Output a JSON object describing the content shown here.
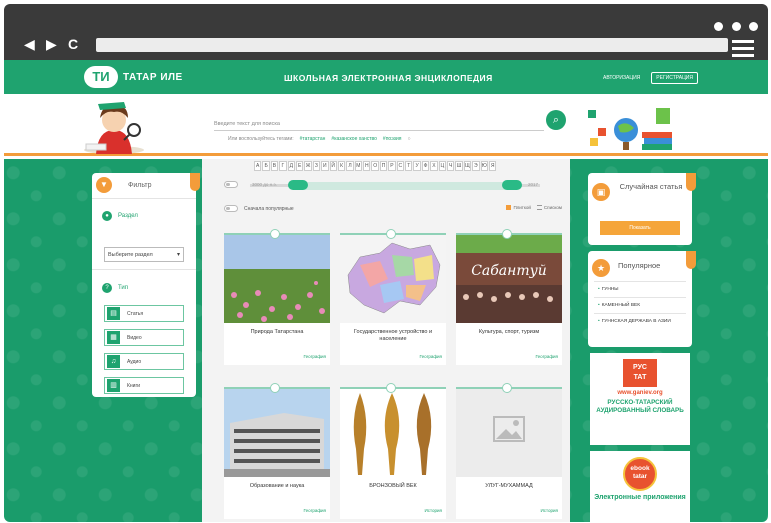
{
  "site": {
    "logo_mark": "ТИ",
    "logo_text": "ТАТАР ИЛЕ",
    "title": "ШКОЛЬНАЯ ЭЛЕКТРОННАЯ ЭНЦИКЛОПЕДИЯ",
    "login": "АВТОРИЗАЦИЯ",
    "register": "РЕГИСТРАЦИЯ"
  },
  "search": {
    "placeholder": "Введите текст для поиска",
    "hint_prefix": "Или воспользуйтесь тегами:",
    "tags": [
      "#татарстан",
      "#казанское ханство",
      "#поэзия"
    ]
  },
  "alphabet": [
    "А",
    "Б",
    "В",
    "Г",
    "Д",
    "Е",
    "Ж",
    "З",
    "И",
    "Й",
    "К",
    "Л",
    "М",
    "Н",
    "О",
    "П",
    "Р",
    "С",
    "Т",
    "У",
    "Ф",
    "Х",
    "Ц",
    "Ч",
    "Ш",
    "Щ",
    "Э",
    "Ю",
    "Я"
  ],
  "year_filter": {
    "from": "3000 до н.э.",
    "to": "2017",
    "range_fraction": [
      0.16,
      0.92
    ]
  },
  "list_options": {
    "popular_first": "Сначала популярные",
    "tile_view": "Плиткой",
    "list_view": "Списком"
  },
  "filter": {
    "title": "Фильтр",
    "section_label": "Раздел",
    "section_select": "Выберите раздел",
    "type_label": "Тип",
    "types": [
      "Статья",
      "Видео",
      "Аудио",
      "Книги"
    ]
  },
  "cards": [
    {
      "title": "Природа Татарстана",
      "tag": "География"
    },
    {
      "title": "Государственное устройство и население",
      "tag": "География"
    },
    {
      "title": "Культура, спорт, туризм",
      "tag": "География"
    },
    {
      "title": "Образование и наука",
      "tag": "География"
    },
    {
      "title": "БРОНЗОВЫЙ ВЕК",
      "tag": "История"
    },
    {
      "title": "УЛУГ-МУХАММАД",
      "tag": "История"
    }
  ],
  "card_image_text": {
    "sabantuy": "Сабантуй"
  },
  "random": {
    "title": "Случайная статья",
    "button": "Показать"
  },
  "popular": {
    "title": "Популярное",
    "items": [
      "ГУННЫ",
      "КАМЕННЫЙ ВЕК",
      "ГУННСКАЯ ДЕРЖАВА В АЗИИ"
    ]
  },
  "promo_dictionary": {
    "logo": "РУС\nТАТ",
    "site": "www.ganiev.org",
    "text": "РУССКО-ТАТАРСКИЙ АУДИРОВАННЫЙ СЛОВАРЬ"
  },
  "promo_ebook": {
    "logo": "ebook tatar",
    "text": "Электронные приложения"
  },
  "colors": {
    "brand_green": "#1fa36f",
    "accent_orange": "#f39c3a",
    "chrome": "#3a3a3a"
  }
}
